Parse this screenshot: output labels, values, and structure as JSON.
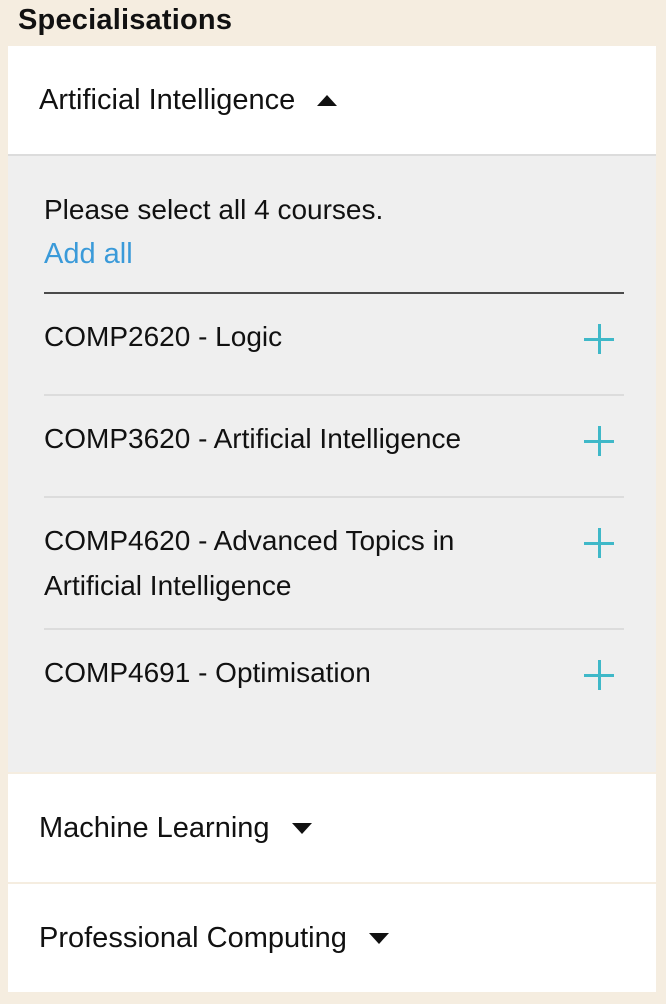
{
  "section_title": "Specialisations",
  "accent_color": "#3a9ad9",
  "plus_color": "#3fb8c8",
  "specialisations": [
    {
      "name": "Artificial Intelligence",
      "expanded": true,
      "caret_icon": "caret-up-icon",
      "instructions": "Please select all 4 courses.",
      "add_all_label": "Add all",
      "courses": [
        {
          "label": "COMP2620 - Logic",
          "action_icon": "plus-icon"
        },
        {
          "label": "COMP3620 - Artificial Intelligence",
          "action_icon": "plus-icon"
        },
        {
          "label": "COMP4620 - Advanced Topics in Artificial Intelligence",
          "action_icon": "plus-icon"
        },
        {
          "label": "COMP4691 - Optimisation",
          "action_icon": "plus-icon"
        }
      ]
    },
    {
      "name": "Machine Learning",
      "expanded": false,
      "caret_icon": "caret-down-icon"
    },
    {
      "name": "Professional Computing",
      "expanded": false,
      "caret_icon": "caret-down-icon"
    }
  ]
}
